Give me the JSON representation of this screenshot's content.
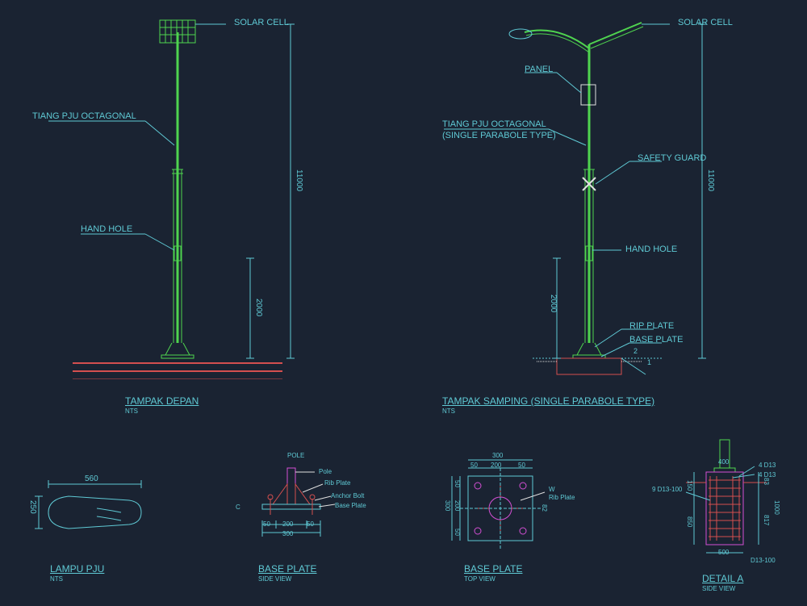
{
  "view1": {
    "title": "TAMPAK DEPAN",
    "subtitle": "NTS",
    "labels": {
      "solar_cell": "SOLAR CELL",
      "tiang": "TIANG PJU OCTAGONAL",
      "hand_hole": "HAND HOLE"
    },
    "dims": {
      "height_total": "11000",
      "height_base": "2000"
    }
  },
  "view2": {
    "title": "TAMPAK SAMPING (SINGLE PARABOLE TYPE)",
    "subtitle": "NTS",
    "labels": {
      "solar_cell": "SOLAR CELL",
      "panel": "PANEL",
      "tiang1": "TIANG PJU OCTAGONAL",
      "tiang2": "(SINGLE PARABOLE TYPE)",
      "safety_guard": "SAFETY GUARD",
      "hand_hole": "HAND HOLE",
      "rip_plate": "RIP PLATE",
      "base_plate": "BASE PLATE"
    },
    "dims": {
      "height_total": "11000",
      "height_base": "2000",
      "slope1": "2",
      "slope2": "1"
    }
  },
  "lampu": {
    "title": "LAMPU PJU",
    "subtitle": "NTS",
    "dims": {
      "w": "560",
      "h": "250"
    }
  },
  "baseplate_side": {
    "title": "BASE PLATE",
    "subtitle": "SIDE VIEW",
    "labels": {
      "pole": "POLE",
      "pole2": "Pole",
      "rib": "Rib Plate",
      "anchor": "Anchor Bolt",
      "base": "Base Plate",
      "c": "C"
    },
    "dims": {
      "a": "50",
      "b": "200",
      "c": "50",
      "d": "300"
    }
  },
  "baseplate_top": {
    "title": "BASE PLATE",
    "subtitle": "TOP VIEW",
    "labels": {
      "w": "W",
      "rib": "Rib Plate"
    },
    "dims": {
      "total": "300",
      "edge": "50",
      "mid": "200",
      "gap": "82"
    }
  },
  "detail_a": {
    "title": "DETAIL A",
    "subtitle": "SIDE VIEW",
    "labels": {
      "bar1": "4 D13",
      "bar2": "4 D13",
      "stirrup_label": "9 D13-100",
      "spacing": "D13-100"
    },
    "dims": {
      "top": "400",
      "h1": "150",
      "h2": "850",
      "w": "500",
      "a": "83",
      "b": "817",
      "t": "1000"
    }
  }
}
